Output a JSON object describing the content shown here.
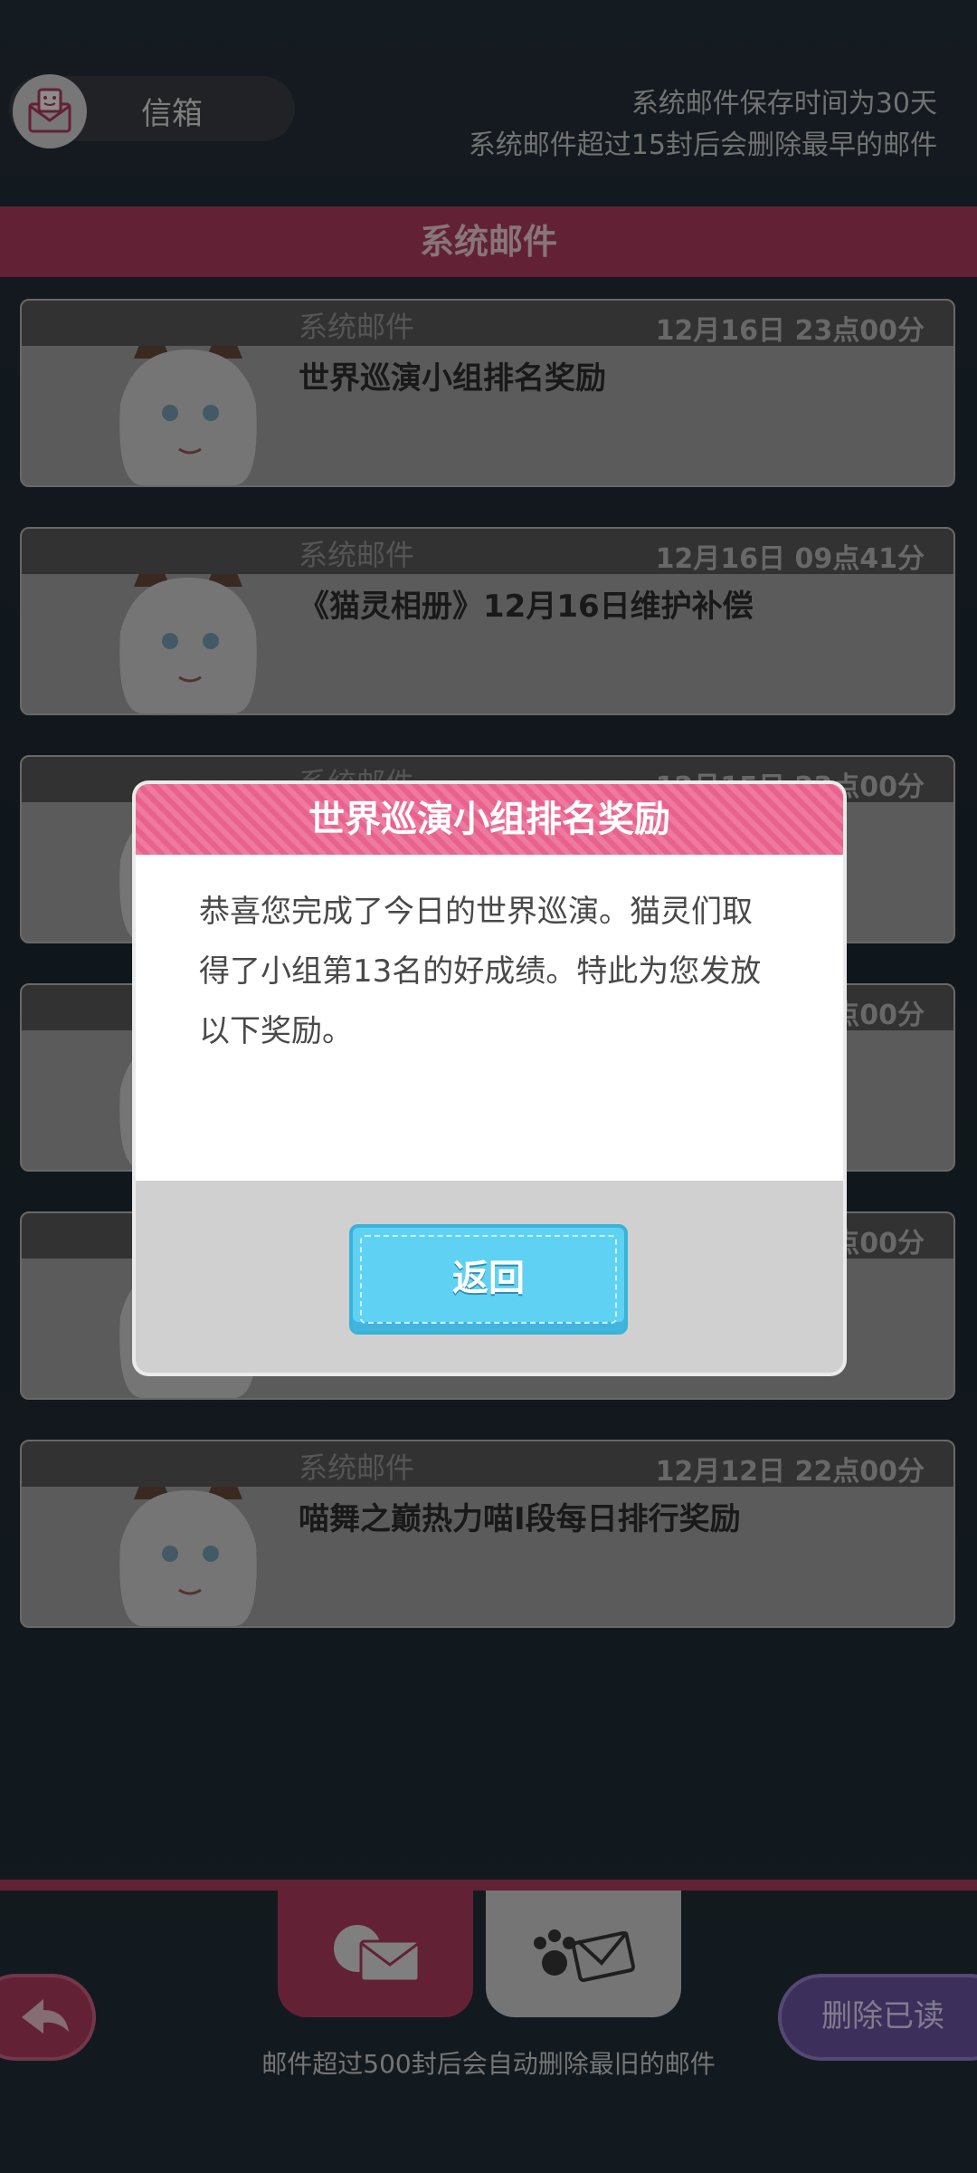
{
  "header": {
    "inbox_label": "信箱",
    "notice_line1": "系统邮件保存时间为30天",
    "notice_line2": "系统邮件超过15封后会删除最早的邮件"
  },
  "section_title": "系统邮件",
  "mails": [
    {
      "type": "系统邮件",
      "time": "12月16日 23点00分",
      "title": "世界巡演小组排名奖励"
    },
    {
      "type": "系统邮件",
      "time": "12月16日 09点41分",
      "title": "《猫灵相册》12月16日维护补偿"
    },
    {
      "type": "系统邮件",
      "time": "12月15日 23点00分",
      "title": ""
    },
    {
      "type": "",
      "time": "点00分",
      "title": ""
    },
    {
      "type": "",
      "time": "点00分",
      "title": ""
    },
    {
      "type": "系统邮件",
      "time": "12月12日 22点00分",
      "title": "喵舞之巅热力喵I段每日排行奖励"
    }
  ],
  "dialog": {
    "title": "世界巡演小组排名奖励",
    "body": "恭喜您完成了今日的世界巡演。猫灵们取得了小组第13名的好成绩。特此为您发放以下奖励。",
    "return_label": "返回"
  },
  "bottom": {
    "delete_label": "删除已读",
    "note": "邮件超过500封后会自动删除最旧的邮件"
  },
  "colors": {
    "accent": "#b43c61",
    "dialog_button": "#5fd2f4",
    "delete_button": "#6f56a8"
  }
}
